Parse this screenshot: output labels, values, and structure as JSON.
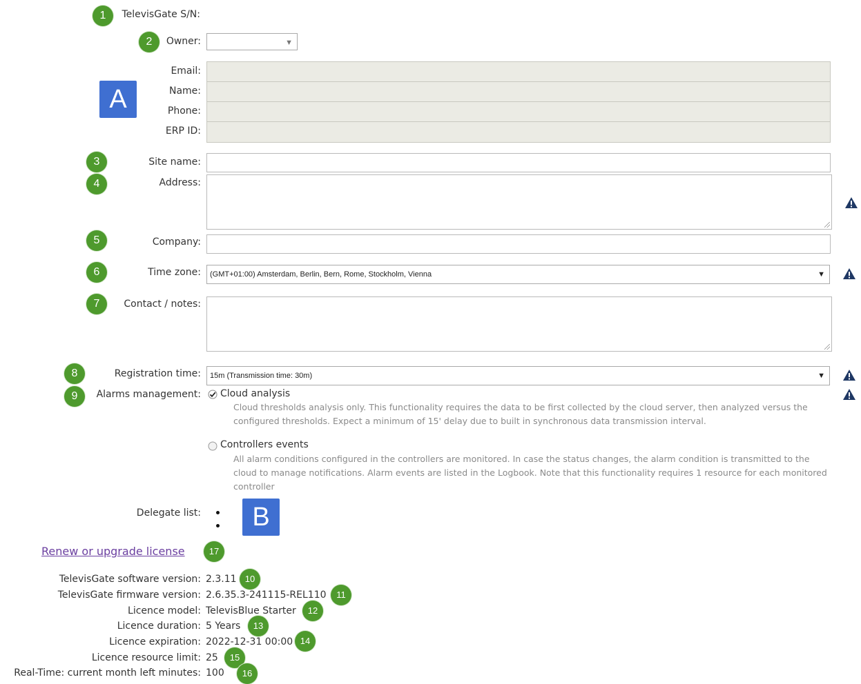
{
  "annotation_badges": [
    "1",
    "2",
    "3",
    "4",
    "5",
    "6",
    "7",
    "8",
    "9",
    "10",
    "11",
    "12",
    "13",
    "14",
    "15",
    "16",
    "17"
  ],
  "annotation_letters": {
    "a": "A",
    "b": "B"
  },
  "labels": {
    "serial": "TelevisGate S/N:",
    "owner": "Owner:",
    "email": "Email:",
    "name": "Name:",
    "phone": "Phone:",
    "erp_id": "ERP ID:",
    "site_name": "Site name:",
    "address": "Address:",
    "company": "Company:",
    "time_zone": "Time zone:",
    "contact_notes": "Contact / notes:",
    "registration_time": "Registration time:",
    "alarms_management": "Alarms management:",
    "delegate_list": "Delegate list:"
  },
  "owner_select": {
    "value": "",
    "arrow": "▼"
  },
  "time_zone_select": {
    "value": "(GMT+01:00) Amsterdam, Berlin, Bern, Rome, Stockholm, Vienna",
    "arrow": "▼"
  },
  "registration_select": {
    "value": "15m (Transmission time: 30m)",
    "arrow": "▼"
  },
  "alarm_options": [
    {
      "label": "Cloud analysis",
      "checked": true,
      "description": "Cloud thresholds analysis only. This functionality requires the data to be first collected by the cloud server, then analyzed versus the configured thresholds. Expect a minimum of 15' delay due to built in synchronous data transmission interval."
    },
    {
      "label": "Controllers events",
      "checked": false,
      "description": "All alarm conditions configured in the controllers are monitored. In case the status changes, the alarm condition is transmitted to the cloud to manage notifications. Alarm events are listed in the Logbook. Note that this functionality requires 1 resource for each monitored controller"
    }
  ],
  "renew_link": "Renew or upgrade license",
  "info": [
    {
      "label": "TelevisGate software version:",
      "value": "2.3.11"
    },
    {
      "label": "TelevisGate firmware version:",
      "value": "2.6.35.3-241115-REL110"
    },
    {
      "label": "Licence model:",
      "value": "TelevisBlue Starter"
    },
    {
      "label": "Licence duration:",
      "value": "5 Years"
    },
    {
      "label": "Licence expiration:",
      "value": "2022-12-31 00:00"
    },
    {
      "label": "Licence resource limit:",
      "value": "25"
    },
    {
      "label": "Real-Time: current month left minutes:",
      "value": "100"
    }
  ],
  "colors": {
    "badge": "#4e9a2d",
    "letter": "#3f6fd1",
    "warning": "#1f3864",
    "link": "#6b3fa0"
  }
}
